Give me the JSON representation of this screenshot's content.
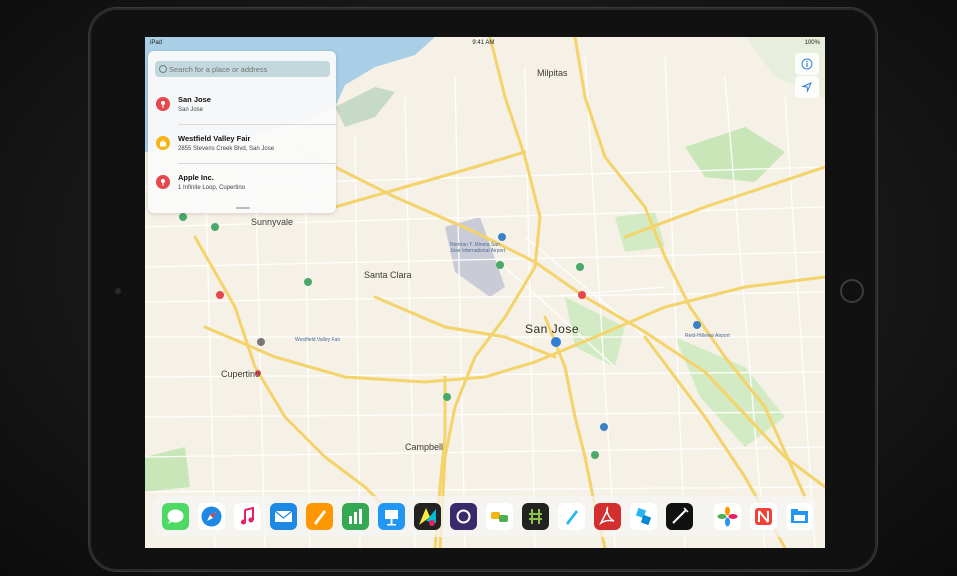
{
  "status_bar": {
    "carrier": "iPad",
    "time": "9:41 AM",
    "battery": "100%"
  },
  "search": {
    "placeholder": "Search for a place or address",
    "results": [
      {
        "title": "San Jose",
        "subtitle": "San Jose",
        "pin_color": "#e5484d",
        "icon": "pin-icon"
      },
      {
        "title": "Westfield Valley Fair",
        "subtitle": "2855 Stevens Creek Blvd, San Jose",
        "pin_color": "#f5b514",
        "icon": "shopping-bag-icon"
      },
      {
        "title": "Apple Inc.",
        "subtitle": "1 Infinite Loop, Cupertino",
        "pin_color": "#e5484d",
        "icon": "pin-icon"
      }
    ]
  },
  "map": {
    "labels": {
      "milpitas": "Milpitas",
      "sunnyvale": "Sunnyvale",
      "santa_clara": "Santa Clara",
      "san_jose": "San Jose",
      "cupertino": "Cupertino",
      "campbell": "Campbell"
    },
    "poi_labels": {
      "airport": "Norman Y. Mineta San Jose International Airport",
      "reid_hillview": "Reid-Hillview Airport",
      "valley_fair": "Westfield Valley Fair"
    },
    "controls": {
      "info": "info-icon",
      "location": "location-arrow-icon"
    },
    "colors": {
      "land": "#f5f1e6",
      "water": "#a8cfe6",
      "park": "#c9e6b8",
      "highway": "#f4d36a",
      "road": "#ffffff"
    }
  },
  "dock": {
    "apps": [
      "Messages",
      "Safari",
      "Music",
      "Mail",
      "Pages",
      "Numbers",
      "Keynote",
      "App 8",
      "App 9",
      "App 10",
      "App 11",
      "App 12",
      "Acrobat",
      "App 14",
      "App 15",
      "Photos",
      "News",
      "App 18"
    ]
  }
}
